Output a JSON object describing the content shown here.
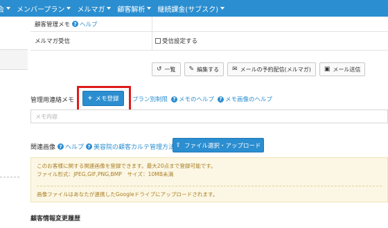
{
  "nav": {
    "items": [
      {
        "label": "会",
        "caret": true
      },
      {
        "label": "メンバープラン",
        "caret": true
      },
      {
        "label": "メルマガ",
        "caret": true
      },
      {
        "label": "顧客解析",
        "caret": true
      },
      {
        "label": "継続課金(サブスク)",
        "caret": true
      }
    ]
  },
  "info": {
    "row1_label": "顧客管理メモ",
    "row1_help": "ヘルプ",
    "row2_label": "メルマガ受信",
    "row2_checkbox_label": "受信設定する"
  },
  "actions": {
    "list": "一覧",
    "edit": "編集する",
    "mail_schedule": "メールの予約配信(メルマガ)",
    "mail_send": "メール送信"
  },
  "memo": {
    "title": "管理用連絡メモ",
    "add_button": "メモ登録",
    "link_plan": "プラン別制限",
    "link_memo_help": "メモのヘルプ",
    "link_memo_image_help": "メモ画像のヘルプ",
    "input_placeholder": "メモ内容"
  },
  "images": {
    "title": "関連画像",
    "help": "ヘルプ",
    "karte_help": "美容院の顧客カルテ管理方法",
    "upload_button": "ファイル選択・アップロード",
    "notice_line1": "このお客様に関する関連画像を登録できます。最大20点まで登録可能です。",
    "notice_line2": "ファイル形式：JPEG,GIF,PNG,BMP　サイズ：10MB未満",
    "notice_line3": "画像ファイルはあなたが連携したGoogleドライブにアップロードされます。"
  },
  "history": {
    "title": "顧客情報変更履歴"
  },
  "colors": {
    "primary": "#2b8ed0",
    "highlight": "#e01a1a",
    "notice_bg": "#fcf7e4",
    "notice_text": "#a87d25"
  },
  "icons": {
    "undo": "undo-icon",
    "edit": "pencil-icon",
    "mail": "envelope-icon",
    "inbox": "inbox-icon",
    "plus": "plus-icon",
    "upload": "upload-icon",
    "help": "question-circle-icon"
  }
}
